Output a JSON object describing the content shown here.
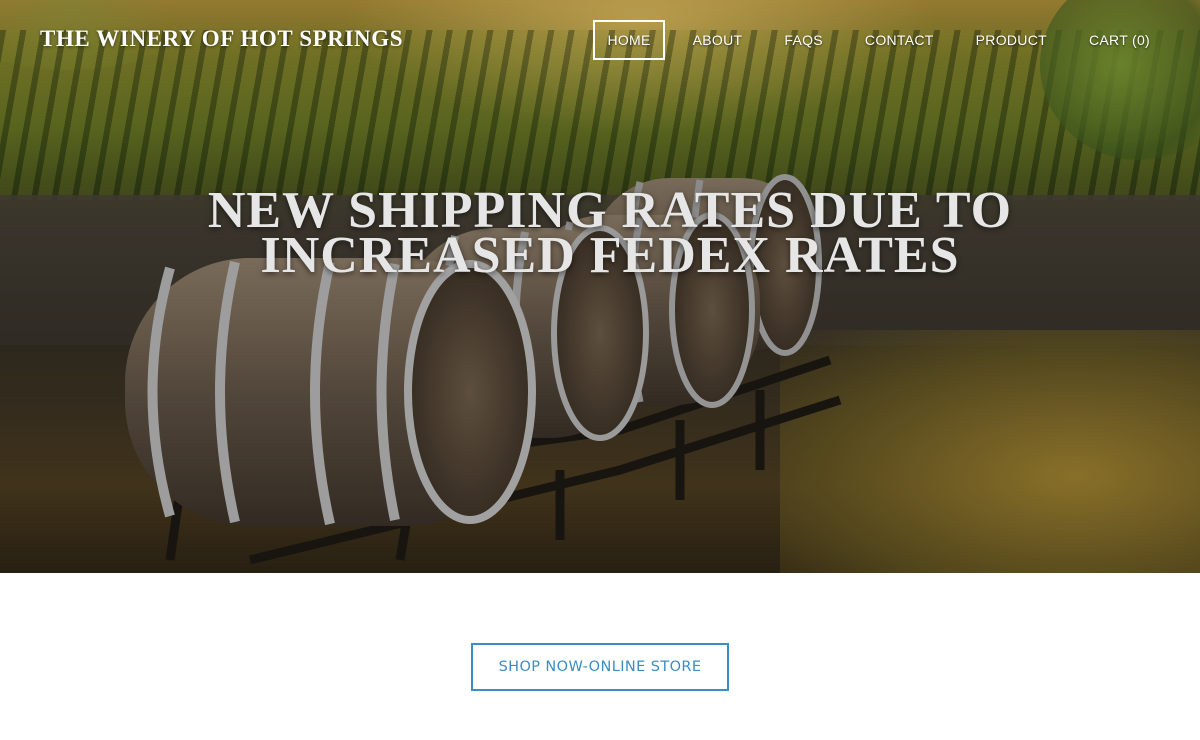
{
  "header": {
    "site_title": "THE WINERY OF HOT SPRINGS",
    "nav": [
      {
        "label": "HOME",
        "active": true
      },
      {
        "label": "ABOUT",
        "active": false
      },
      {
        "label": "FAQS",
        "active": false
      },
      {
        "label": "CONTACT",
        "active": false
      },
      {
        "label": "PRODUCT",
        "active": false
      },
      {
        "label": "CART (0)",
        "active": false
      }
    ]
  },
  "hero": {
    "headline_line1": "NEW SHIPPING RATES DUE TO",
    "headline_line2": "INCREASED FEDEX RATES"
  },
  "cta": {
    "label": "SHOP NOW-ONLINE STORE"
  },
  "colors": {
    "accent": "#3a8dc5",
    "headline": "#e6e6e6",
    "nav_text": "#ffffff"
  }
}
